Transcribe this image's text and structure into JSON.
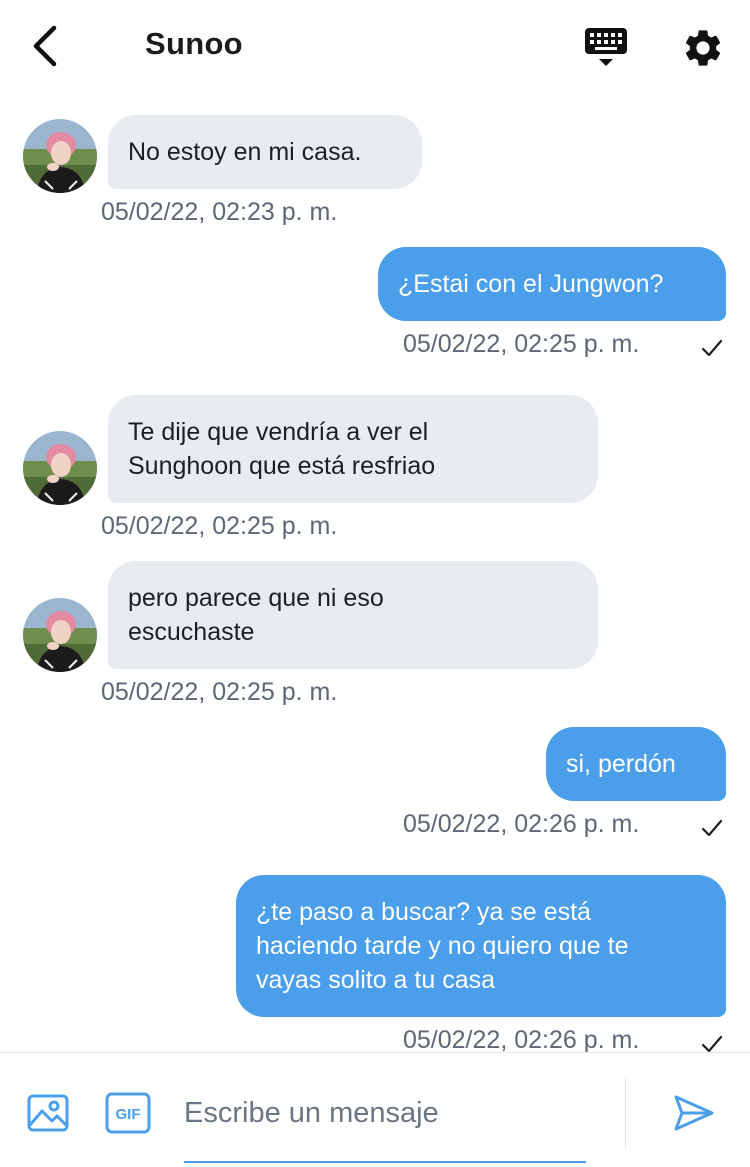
{
  "header": {
    "title": "Sunoo",
    "back_icon": "chevron-left-icon",
    "keyboard_icon": "keyboard-shortcuts-icon",
    "settings_icon": "gear-icon"
  },
  "messages": [
    {
      "direction": "in",
      "text": "No estoy en mi casa.",
      "time": "05/02/22, 02:23 p. m."
    },
    {
      "direction": "out",
      "text": "¿Estai con el Jungwon?",
      "time": "05/02/22, 02:25 p. m.",
      "status": "sent"
    },
    {
      "direction": "in",
      "lines": [
        "Te dije que vendría a ver el",
        "Sunghoon que está resfriao"
      ],
      "time": "05/02/22, 02:25 p. m."
    },
    {
      "direction": "in",
      "lines": [
        "pero parece que ni eso",
        "escuchaste"
      ],
      "time": "05/02/22, 02:25 p. m."
    },
    {
      "direction": "out",
      "text": "si, perdón",
      "time": "05/02/22, 02:26 p. m.",
      "status": "sent"
    },
    {
      "direction": "out",
      "lines": [
        "¿te paso a buscar? ya se está",
        "haciendo tarde y no quiero que te",
        "vayas solito a tu casa"
      ],
      "time": "05/02/22, 02:26 p. m.",
      "status": "sent"
    }
  ],
  "composer": {
    "placeholder": "Escribe un mensaje",
    "value": "",
    "image_icon": "image-icon",
    "gif_icon": "gif-icon",
    "send_icon": "send-icon"
  },
  "colors": {
    "outgoing_bubble": "#4b9fea",
    "incoming_bubble": "#e8ebef",
    "timestamp": "#5d6775",
    "accent": "#4b9fea"
  }
}
